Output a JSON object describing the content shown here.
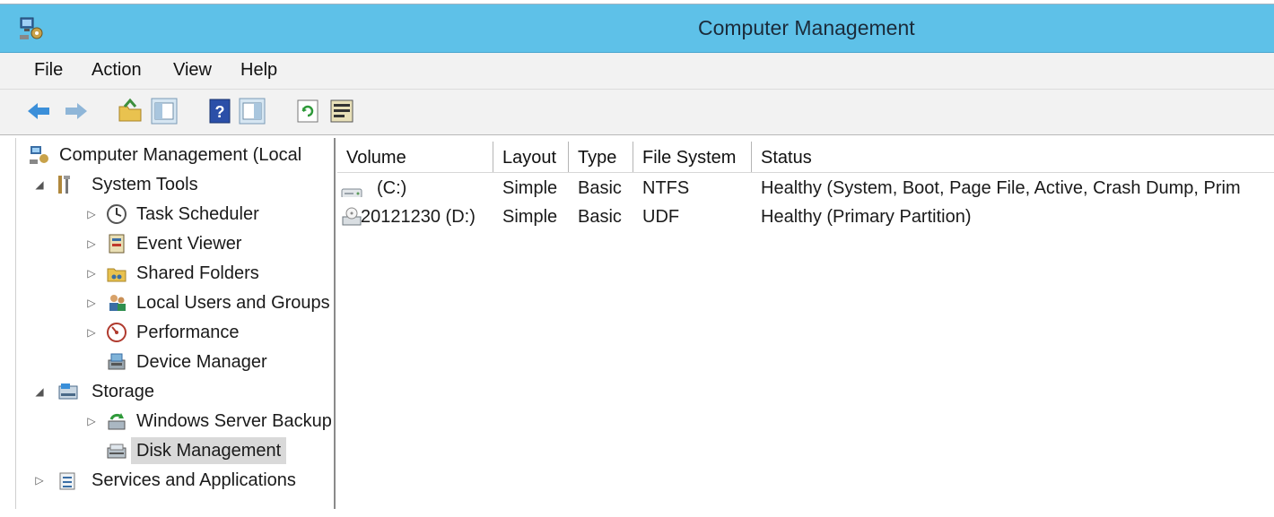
{
  "window": {
    "title": "Computer Management",
    "accent": "#5ec1e8"
  },
  "menu": [
    "File",
    "Action",
    "View",
    "Help"
  ],
  "toolbar": {
    "buttons": [
      "back-arrow-icon",
      "forward-arrow-icon",
      "up-folder-icon",
      "show-hide-tree-icon",
      "help-icon",
      "show-hide-action-pane-icon",
      "refresh-icon",
      "export-list-icon"
    ]
  },
  "tree": {
    "root": "Computer Management (Local",
    "system_tools": "System Tools",
    "task_scheduler": "Task Scheduler",
    "event_viewer": "Event Viewer",
    "shared_folders": "Shared Folders",
    "local_users": "Local Users and Groups",
    "performance": "Performance",
    "device_manager": "Device Manager",
    "storage": "Storage",
    "backup": "Windows Server Backup",
    "disk_management": "Disk Management",
    "services": "Services and Applications"
  },
  "columns": [
    "Volume",
    "Layout",
    "Type",
    "File System",
    "Status"
  ],
  "rows": [
    {
      "volume": "(C:)",
      "layout": "Simple",
      "type": "Basic",
      "fs": "NTFS",
      "status": "Healthy (System, Boot, Page File, Active, Crash Dump, Prim"
    },
    {
      "volume": "20121230 (D:)",
      "layout": "Simple",
      "type": "Basic",
      "fs": "UDF",
      "status": "Healthy (Primary Partition)"
    }
  ]
}
